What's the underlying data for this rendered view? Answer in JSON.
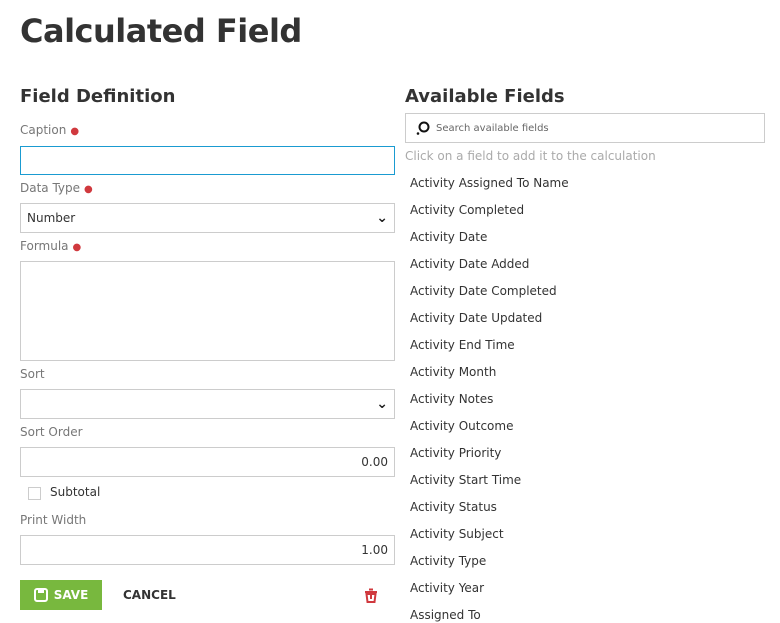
{
  "title": "Calculated Field",
  "definition": {
    "heading": "Field Definition",
    "caption_label": "Caption",
    "caption_value": "",
    "datatype_label": "Data Type",
    "datatype_value": "Number",
    "formula_label": "Formula",
    "formula_value": "",
    "sort_label": "Sort",
    "sort_value": "",
    "sort_order_label": "Sort Order",
    "sort_order_value": "0.00",
    "subtotal_label": "Subtotal",
    "subtotal_checked": false,
    "print_width_label": "Print Width",
    "print_width_value": "1.00",
    "save_label": "SAVE",
    "cancel_label": "CANCEL",
    "required_marker": "●"
  },
  "available": {
    "heading": "Available Fields",
    "search_placeholder": "Search available fields",
    "hint": "Click on a field to add it to the calculation",
    "fields": [
      "Activity Assigned To Name",
      "Activity Completed",
      "Activity Date",
      "Activity Date Added",
      "Activity Date Completed",
      "Activity Date Updated",
      "Activity End Time",
      "Activity Month",
      "Activity Notes",
      "Activity Outcome",
      "Activity Priority",
      "Activity Start Time",
      "Activity Status",
      "Activity Subject",
      "Activity Type",
      "Activity Year",
      "Assigned To"
    ]
  },
  "colors": {
    "accent": "#1a9bd1",
    "save": "#78b83e",
    "danger": "#d0393e"
  }
}
